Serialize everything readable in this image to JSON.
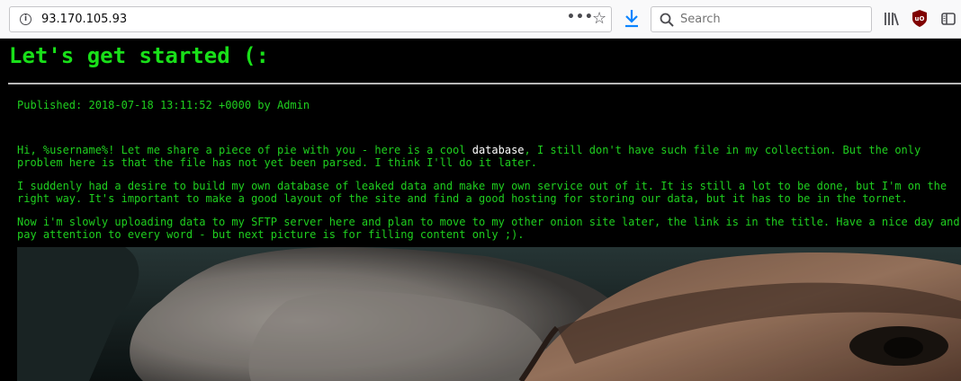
{
  "browser": {
    "url": "93.170.105.93",
    "search_placeholder": "Search",
    "icons": [
      "info-icon",
      "page-actions-icon",
      "bookmark-star-icon",
      "download-icon",
      "search-icon",
      "library-icon",
      "ublock-icon",
      "sidebar-icon"
    ]
  },
  "site": {
    "title": "Let's get started (:"
  },
  "post": {
    "published": "Published: 2018-07-18 13:11:52 +0000 by Admin",
    "p1_before": "Hi, %username%! Let me share a piece of pie with you - here is a cool ",
    "p1_link": "database",
    "p1_after": ", I still don't have such file in my collection. But the only problem here is that the file has not yet been parsed. I think I'll do it later.",
    "p2": "I suddenly had a desire to build my own database of leaked data and make my own service out of it. It is still a lot to be done, but I'm on the right way. It's important to make a good layout of the site and find a good hosting for storing our data, but it has to be in the tornet.",
    "p3": "Now i'm slowly uploading data to my SFTP server here and plan to move to my other onion site later, the link is in the title. Have a nice day and pay attention to every word - but next picture is for filling content only ;)."
  },
  "colors": {
    "page_bg": "#000000",
    "title_green": "#19e019",
    "text_green": "#1fcf1f",
    "link_white": "#ffffff"
  }
}
